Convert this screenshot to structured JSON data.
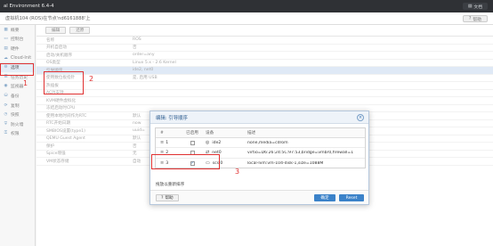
{
  "topbar": {
    "title": "al Environment 6.4-4",
    "doc_label": "文档"
  },
  "vm_header": {
    "title": "虚拟机104 (ROS)在节点'nd6161888'上",
    "help_label": "帮助"
  },
  "nav": {
    "items": [
      {
        "label": "概要",
        "icon": "summary-icon"
      },
      {
        "label": "控制台",
        "icon": "console-icon"
      },
      {
        "label": "硬件",
        "icon": "hardware-icon"
      },
      {
        "label": "Cloud-Init",
        "icon": "cloud-icon"
      },
      {
        "label": "选项",
        "icon": "options-icon"
      },
      {
        "label": "任务历史",
        "icon": "task-history-icon"
      },
      {
        "label": "监视器",
        "icon": "monitor-icon"
      },
      {
        "label": "备份",
        "icon": "backup-icon"
      },
      {
        "label": "复制",
        "icon": "replication-icon"
      },
      {
        "label": "快照",
        "icon": "snapshot-icon"
      },
      {
        "label": "防火墙",
        "icon": "firewall-icon"
      },
      {
        "label": "权限",
        "icon": "permissions-icon"
      }
    ]
  },
  "toolbar": {
    "edit_label": "编辑",
    "revert_label": "还原"
  },
  "options_rows": [
    {
      "key": "名称",
      "value": "ROS"
    },
    {
      "key": "开机自启动",
      "value": "否"
    },
    {
      "key": "启动/关机顺序",
      "value": "order=any"
    },
    {
      "key": "OS类型",
      "value": "Linux 5.x - 2.6 Kernel"
    },
    {
      "key": "引导顺序",
      "value": "ide2, net0"
    },
    {
      "key": "使用数位板指针",
      "value": "是, 启用 USB"
    },
    {
      "key": "热插拔",
      "value": ""
    },
    {
      "key": "ACPI支持",
      "value": ""
    },
    {
      "key": "KVM硬件虚拟化",
      "value": ""
    },
    {
      "key": "冻结启动时CPU",
      "value": ""
    },
    {
      "key": "使用本地时间作为RTC",
      "value": "默认"
    },
    {
      "key": "RTC开始日期",
      "value": "now"
    },
    {
      "key": "SMBIOS设置(type1)",
      "value": "uuid="
    },
    {
      "key": "QEMU Guest Agent",
      "value": "默认"
    },
    {
      "key": "保护",
      "value": "否"
    },
    {
      "key": "Spice增强",
      "value": "无"
    },
    {
      "key": "VM状态存储",
      "value": "自动"
    }
  ],
  "annotations": {
    "n1": "1",
    "n2": "2",
    "n3": "3"
  },
  "dialog": {
    "title": "编辑: 引导顺序",
    "headers": {
      "num": "#",
      "enabled": "已启用",
      "device": "设备",
      "desc": "描述"
    },
    "rows": [
      {
        "num": "1",
        "enabled": false,
        "device": "ide2",
        "device_icon": "cdrom-icon",
        "desc": "none,media=cdrom"
      },
      {
        "num": "2",
        "enabled": false,
        "device": "net0",
        "device_icon": "network-icon",
        "desc": "virtio=D6:26:24:5C:97:53,bridge=vmbr0,firewall=1"
      },
      {
        "num": "3",
        "enabled": true,
        "device": "scsi0",
        "device_icon": "disk-icon",
        "desc": "local-lvm:vm-104-disk-1,size=1088M"
      }
    ],
    "hint": "拖放以重新排序",
    "help_label": "帮助",
    "ok_label": "确定",
    "reset_label": "Reset"
  }
}
